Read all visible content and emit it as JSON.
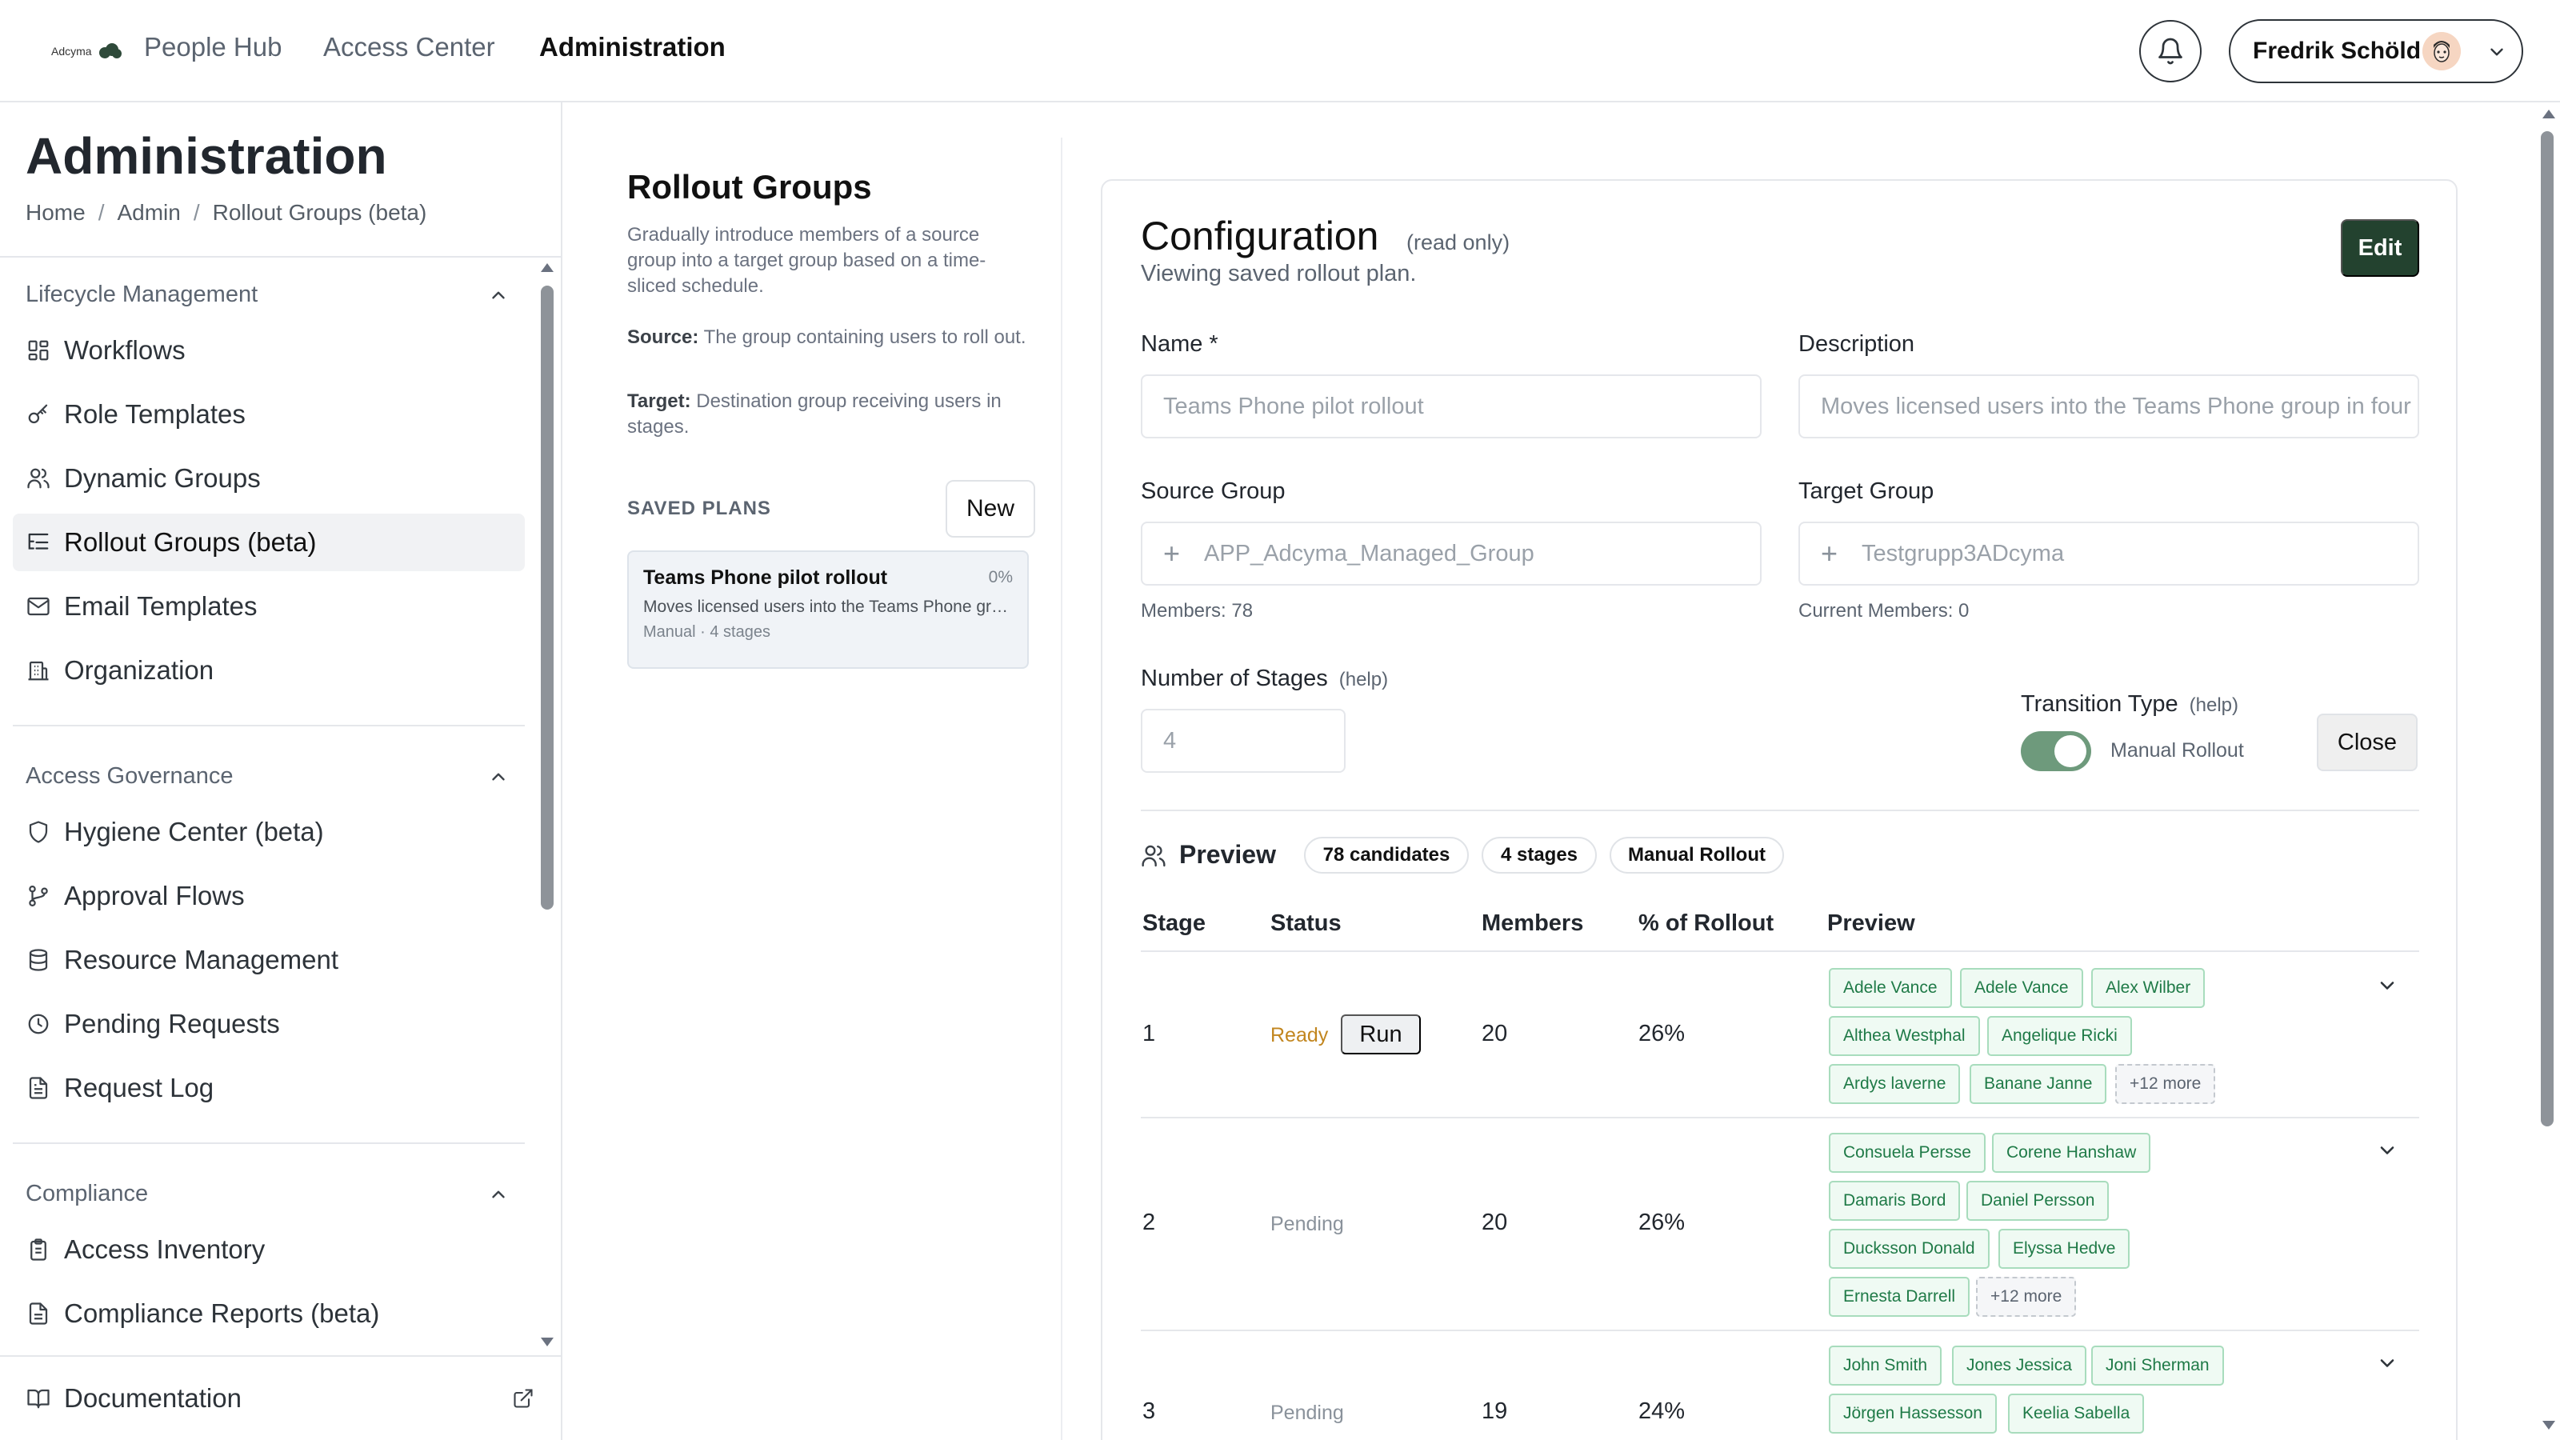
{
  "header": {
    "logo_text": "Adcyma",
    "nav": [
      "People Hub",
      "Access Center",
      "Administration"
    ],
    "active_nav": "Administration",
    "user_name": "Fredrik Schöld"
  },
  "sidebar": {
    "page_title": "Administration",
    "breadcrumb": [
      "Home",
      "Admin",
      "Rollout Groups (beta)"
    ],
    "sections": [
      {
        "title": "Lifecycle Management",
        "items": [
          "Workflows",
          "Role Templates",
          "Dynamic Groups",
          "Rollout Groups (beta)",
          "Email Templates",
          "Organization"
        ]
      },
      {
        "title": "Access Governance",
        "items": [
          "Hygiene Center (beta)",
          "Approval Flows",
          "Resource Management",
          "Pending Requests",
          "Request Log"
        ]
      },
      {
        "title": "Compliance",
        "items": [
          "Access Inventory",
          "Compliance Reports (beta)"
        ]
      }
    ],
    "active_item": "Rollout Groups (beta)",
    "documentation": "Documentation"
  },
  "rollout": {
    "title": "Rollout Groups",
    "description": "Gradually introduce members of a source group into a target group based on a time-sliced schedule.",
    "source_label": "Source:",
    "source_text": "The group containing users to roll out.",
    "target_label": "Target:",
    "target_text": "Destination group receiving users in stages.",
    "saved_plans_label": "SAVED PLANS",
    "new_label": "New",
    "plans": [
      {
        "name": "Teams Phone pilot rollout",
        "percent": "0%",
        "description": "Moves licensed users into the Teams Phone group in four stages.",
        "meta": "Manual · 4 stages"
      }
    ]
  },
  "config": {
    "title": "Configuration",
    "read_only": "(read only)",
    "subtitle": "Viewing saved rollout plan.",
    "edit_label": "Edit",
    "name_label": "Name *",
    "name_value": "Teams Phone pilot rollout",
    "description_label": "Description",
    "description_value": "Moves licensed users into the Teams Phone group in four stages.",
    "source_label": "Source Group",
    "source_value": "APP_Adcyma_Managed_Group",
    "source_hint": "Members: 78",
    "target_label": "Target Group",
    "target_value": "Testgrupp3ADcyma",
    "target_hint": "Current Members: 0",
    "stages_label": "Number of Stages",
    "stages_help": "(help)",
    "stages_value": "4",
    "transition_label": "Transition Type",
    "transition_help": "(help)",
    "transition_value": "Manual Rollout",
    "close_label": "Close"
  },
  "preview": {
    "title": "Preview",
    "chips": [
      "78 candidates",
      "4 stages",
      "Manual Rollout"
    ],
    "columns": [
      "Stage",
      "Status",
      "Members",
      "% of Rollout",
      "Preview"
    ],
    "run_label": "Run",
    "rows": [
      {
        "stage": "1",
        "status": "Ready",
        "members": "20",
        "percent": "26%",
        "names": [
          "Adele Vance",
          "Adele Vance",
          "Alex Wilber",
          "Althea Westphal",
          "Angelique Ricki",
          "Ardys laverne",
          "Banane Janne"
        ],
        "more": "+12 more"
      },
      {
        "stage": "2",
        "status": "Pending",
        "members": "20",
        "percent": "26%",
        "names": [
          "Consuela Persse",
          "Corene Hanshaw",
          "Damaris Bord",
          "Daniel Persson",
          "Ducksson Donald",
          "Elyssa Hedve",
          "Ernesta Darrell"
        ],
        "more": "+12 more"
      },
      {
        "stage": "3",
        "status": "Pending",
        "members": "19",
        "percent": "24%",
        "names": [
          "John Smith",
          "Jones Jessica",
          "Joni Sherman",
          "Jörgen Hassesson",
          "Keelia Sabella"
        ],
        "more": ""
      }
    ]
  },
  "colors": {
    "accent": "#23422f",
    "ready": "#c2861f",
    "tag_border": "#a8dcbd",
    "tag_bg": "#effaf3",
    "tag_text": "#1f7a47",
    "toggle": "#6e9a7c"
  }
}
